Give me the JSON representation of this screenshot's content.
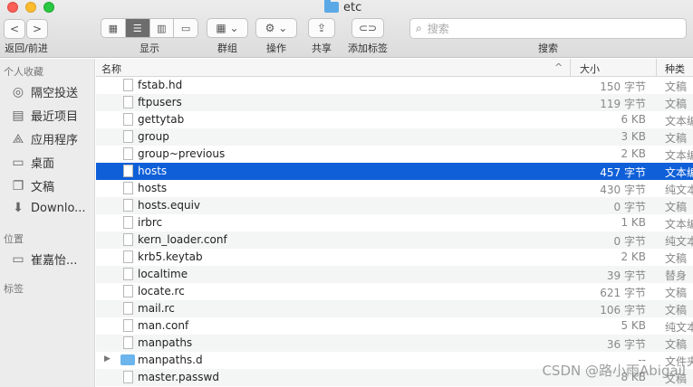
{
  "window": {
    "title": "etc"
  },
  "toolbar": {
    "back_label": "<",
    "forward_label": ">",
    "nav_label": "返回/前进",
    "view_label": "显示",
    "group_label": "群组",
    "action_label": "操作",
    "share_label": "共享",
    "tag_label": "添加标签",
    "search_label": "搜索",
    "search_placeholder": "搜索"
  },
  "sidebar": {
    "favorites_header": "个人收藏",
    "favorites": [
      {
        "label": "隔空投送",
        "icon": "airdrop-icon"
      },
      {
        "label": "最近项目",
        "icon": "recents-icon"
      },
      {
        "label": "应用程序",
        "icon": "applications-icon"
      },
      {
        "label": "桌面",
        "icon": "desktop-icon"
      },
      {
        "label": "文稿",
        "icon": "documents-icon"
      },
      {
        "label": "Downlo...",
        "icon": "downloads-icon"
      }
    ],
    "locations_header": "位置",
    "locations": [
      {
        "label": "崔嘉怡...",
        "icon": "computer-icon"
      }
    ],
    "tags_header": "标签"
  },
  "columns": {
    "name": "名称",
    "size": "大小",
    "kind": "种类"
  },
  "files": [
    {
      "name": "fstab.hd",
      "size": "150 字节",
      "kind": "文稿"
    },
    {
      "name": "ftpusers",
      "size": "119 字节",
      "kind": "文稿"
    },
    {
      "name": "gettytab",
      "size": "6 KB",
      "kind": "文本编"
    },
    {
      "name": "group",
      "size": "3 KB",
      "kind": "文稿"
    },
    {
      "name": "group~previous",
      "size": "2 KB",
      "kind": "文本编"
    },
    {
      "name": "hosts",
      "size": "457 字节",
      "kind": "文本编"
    },
    {
      "name": "hosts",
      "size": "430 字节",
      "kind": "纯文本"
    },
    {
      "name": "hosts.equiv",
      "size": "0 字节",
      "kind": "文稿"
    },
    {
      "name": "irbrc",
      "size": "1 KB",
      "kind": "文本编"
    },
    {
      "name": "kern_loader.conf",
      "size": "0 字节",
      "kind": "纯文本"
    },
    {
      "name": "krb5.keytab",
      "size": "2 KB",
      "kind": "文稿"
    },
    {
      "name": "localtime",
      "size": "39 字节",
      "kind": "替身"
    },
    {
      "name": "locate.rc",
      "size": "621 字节",
      "kind": "文稿"
    },
    {
      "name": "mail.rc",
      "size": "106 字节",
      "kind": "文稿"
    },
    {
      "name": "man.conf",
      "size": "5 KB",
      "kind": "纯文本"
    },
    {
      "name": "manpaths",
      "size": "36 字节",
      "kind": "文稿"
    },
    {
      "name": "manpaths.d",
      "size": "--",
      "kind": "文件夹"
    },
    {
      "name": "master.passwd",
      "size": "8 KB",
      "kind": "文稿"
    }
  ],
  "selected_index": 5,
  "watermark": "CSDN @路小雨Abigail"
}
